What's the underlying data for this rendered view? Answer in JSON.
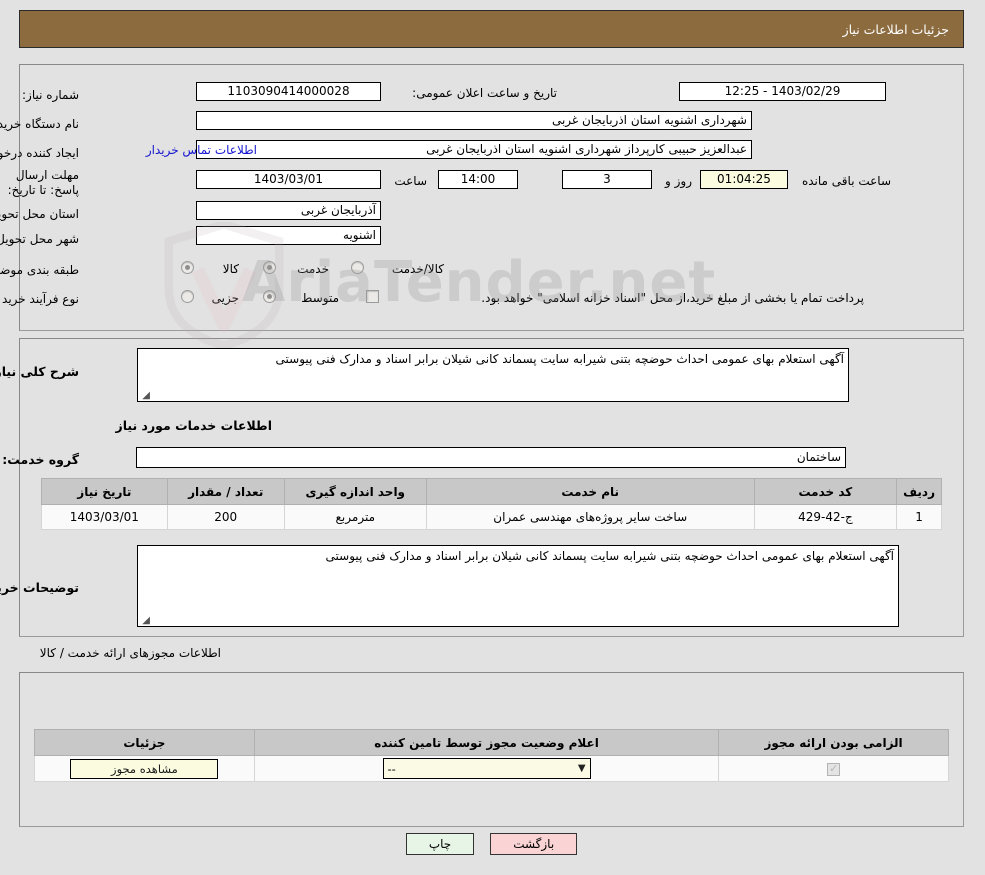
{
  "header": {
    "title": "جزئیات اطلاعات نیاز"
  },
  "form": {
    "need_number_label": "شماره نیاز:",
    "need_number_value": "1103090414000028",
    "announce_label": "تاریخ و ساعت اعلان عمومی:",
    "announce_value": "1403/02/29 - 12:25",
    "buyer_org_label": "نام دستگاه خریدار:",
    "buyer_org_value": "شهرداری اشنویه استان اذربایجان غربی",
    "creator_label": "ایجاد کننده درخواست:",
    "creator_value": "عبدالعزیز حبیبی کارپرداز شهرداری اشنویه استان اذربایجان غربی",
    "contact_link": "اطلاعات تماس خریدار",
    "deadline_label": "مهلت ارسال پاسخ: تا تاریخ:",
    "deadline_date": "1403/03/01",
    "deadline_hour_label": "ساعت",
    "deadline_hour": "14:00",
    "remaining_days": "3",
    "remaining_days_suffix": "روز و",
    "remaining_time": "01:04:25",
    "remaining_suffix": "ساعت باقی مانده",
    "province_label": "استان محل تحویل:",
    "province_value": "آذربایجان غربی",
    "city_label": "شهر محل تحویل:",
    "city_value": "اشنویه",
    "category_label": "طبقه بندی موضوعی:",
    "category_options": [
      {
        "label": "کالا",
        "selected": false
      },
      {
        "label": "خدمت",
        "selected": true
      },
      {
        "label": "کالا/خدمت",
        "selected": false
      }
    ],
    "process_label": "نوع فرآیند خرید :",
    "process_options": [
      {
        "label": "جزیی",
        "selected": false
      },
      {
        "label": "متوسط",
        "selected": true
      }
    ],
    "treasury_checkbox_label": "پرداخت تمام یا بخشی از مبلغ خرید،از محل \"اسناد خزانه اسلامی\" خواهد بود.",
    "treasury_checked": false
  },
  "summary": {
    "label": "شرح کلی نیاز:",
    "value": "آگهی استعلام بهای عمومی احداث حوضچه بتنی شیرابه سایت پسماند کانی شیلان برابر اسناد و مدارک فنی پیوستی"
  },
  "services_section": {
    "subtitle": "اطلاعات خدمات مورد نیاز",
    "group_label": "گروه خدمت:",
    "group_value": "ساختمان",
    "table": {
      "headers": [
        "ردیف",
        "کد خدمت",
        "نام خدمت",
        "واحد اندازه گیری",
        "تعداد / مقدار",
        "تاریخ نیاز"
      ],
      "rows": [
        [
          "1",
          "ج-42-429",
          "ساخت سایر پروژه‌های مهندسی عمران",
          "مترمربع",
          "200",
          "1403/03/01"
        ]
      ]
    }
  },
  "buyer_notes": {
    "label": "توضیحات خریدار;",
    "value": "آگهی استعلام بهای عمومی احداث حوضچه بتنی شیرابه سایت پسماند کانی شیلان برابر اسناد و مدارک فنی پیوستی"
  },
  "permits": {
    "section_label": "اطلاعات مجوزهای ارائه خدمت / کالا",
    "headers": [
      "الزامی بودن ارائه مجوز",
      "اعلام وضعیت مجوز توسط تامین کننده",
      "جزئیات"
    ],
    "rows": [
      {
        "required": true,
        "status_value": "--",
        "detail_button": "مشاهده مجوز"
      }
    ]
  },
  "footer": {
    "print_label": "چاپ",
    "back_label": "بازگشت"
  },
  "watermark": {
    "text": "AriaTender.net"
  },
  "colors": {
    "header_bg": "#8c6b3f",
    "page_bg": "#e2e2e2",
    "link": "#1415d0",
    "print_btn": "#e6f5e6",
    "back_btn": "#fad4d4",
    "highlight_field": "#fbfbe0"
  }
}
